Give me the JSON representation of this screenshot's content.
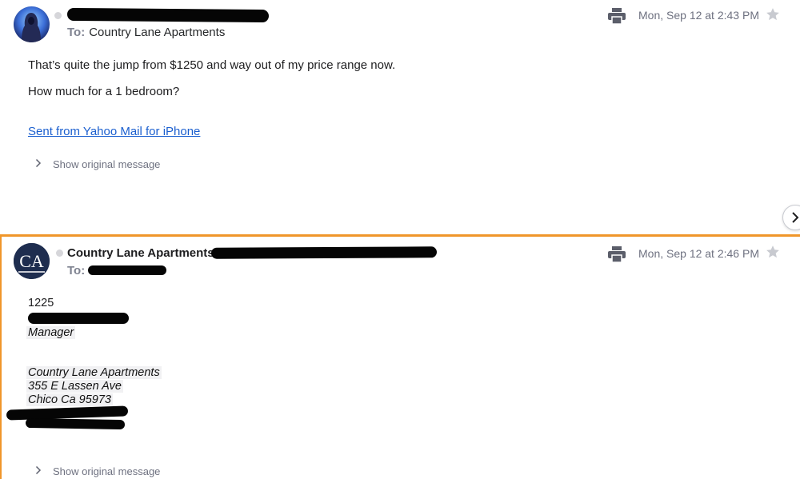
{
  "messages": [
    {
      "sender_name": "",
      "to_label": "To:",
      "to_name": "Country Lane Apartments",
      "date": "Mon, Sep 12 at 2:43 PM",
      "body": [
        "That’s quite the jump from $1250 and way out of my price range now.",
        "How much for a 1 bedroom?"
      ],
      "signature_link": "Sent from Yahoo Mail for iPhone",
      "show_original": "Show original message"
    },
    {
      "sender_name": "Country Lane Apartments",
      "avatar_initials": "CA",
      "to_label": "To:",
      "date": "Mon, Sep 12 at 2:46 PM",
      "body": [
        "1225"
      ],
      "signature": [
        "Manager",
        "Country Lane Apartments",
        "355 E Lassen Ave",
        "Chico Ca 95973"
      ],
      "show_original": "Show original message"
    }
  ],
  "icons": {
    "print": "printer-icon",
    "star": "star-icon",
    "expand": "chevron-right-icon",
    "next": "chevron-right-icon"
  },
  "colors": {
    "accent_border": "#f0962a",
    "link": "#1b5fcf",
    "avatar_ca_bg": "#1e2d4f"
  }
}
